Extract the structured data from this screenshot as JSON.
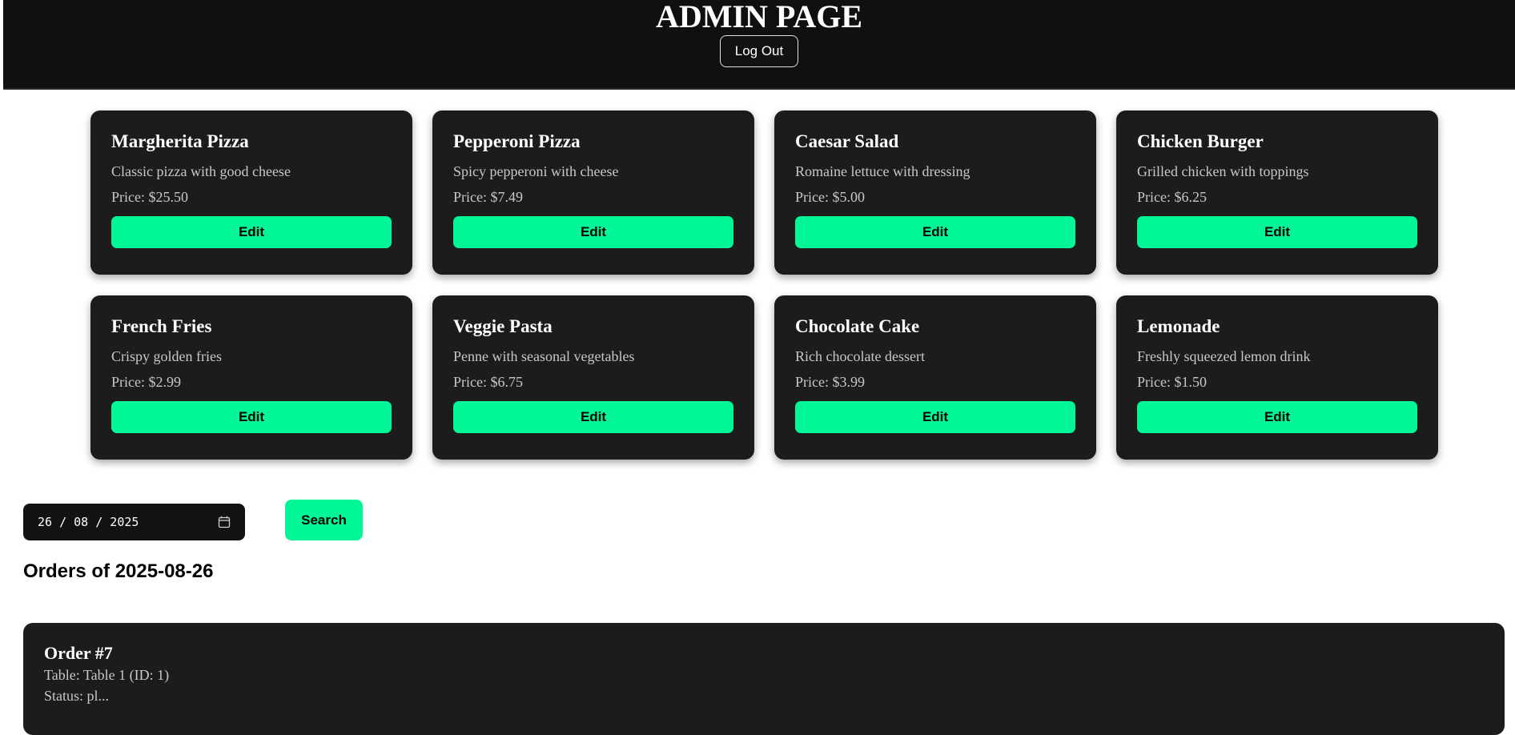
{
  "header": {
    "title": "ADMIN PAGE",
    "logout_label": "Log Out"
  },
  "menu": {
    "items": [
      {
        "name": "Margherita Pizza",
        "description": "Classic pizza with good cheese",
        "price": "Price: $25.50",
        "edit_label": "Edit"
      },
      {
        "name": "Pepperoni Pizza",
        "description": "Spicy pepperoni with cheese",
        "price": "Price: $7.49",
        "edit_label": "Edit"
      },
      {
        "name": "Caesar Salad",
        "description": "Romaine lettuce with dressing",
        "price": "Price: $5.00",
        "edit_label": "Edit"
      },
      {
        "name": "Chicken Burger",
        "description": "Grilled chicken with toppings",
        "price": "Price: $6.25",
        "edit_label": "Edit"
      },
      {
        "name": "French Fries",
        "description": "Crispy golden fries",
        "price": "Price: $2.99",
        "edit_label": "Edit"
      },
      {
        "name": "Veggie Pasta",
        "description": "Penne with seasonal vegetables",
        "price": "Price: $6.75",
        "edit_label": "Edit"
      },
      {
        "name": "Chocolate Cake",
        "description": "Rich chocolate dessert",
        "price": "Price: $3.99",
        "edit_label": "Edit"
      },
      {
        "name": "Lemonade",
        "description": "Freshly squeezed lemon drink",
        "price": "Price: $1.50",
        "edit_label": "Edit"
      }
    ]
  },
  "date_filter": {
    "value": "26 / 08 / 2025",
    "icon": "calendar-icon",
    "search_label": "Search"
  },
  "orders": {
    "heading": "Orders of 2025-08-26",
    "list": [
      {
        "title": "Order #7",
        "table": "Table: Table 1 (ID: 1)",
        "status": "Status: pl..."
      }
    ]
  },
  "colors": {
    "accent": "#00f696",
    "card_bg": "#1c1c1c",
    "header_bg": "#101010"
  }
}
